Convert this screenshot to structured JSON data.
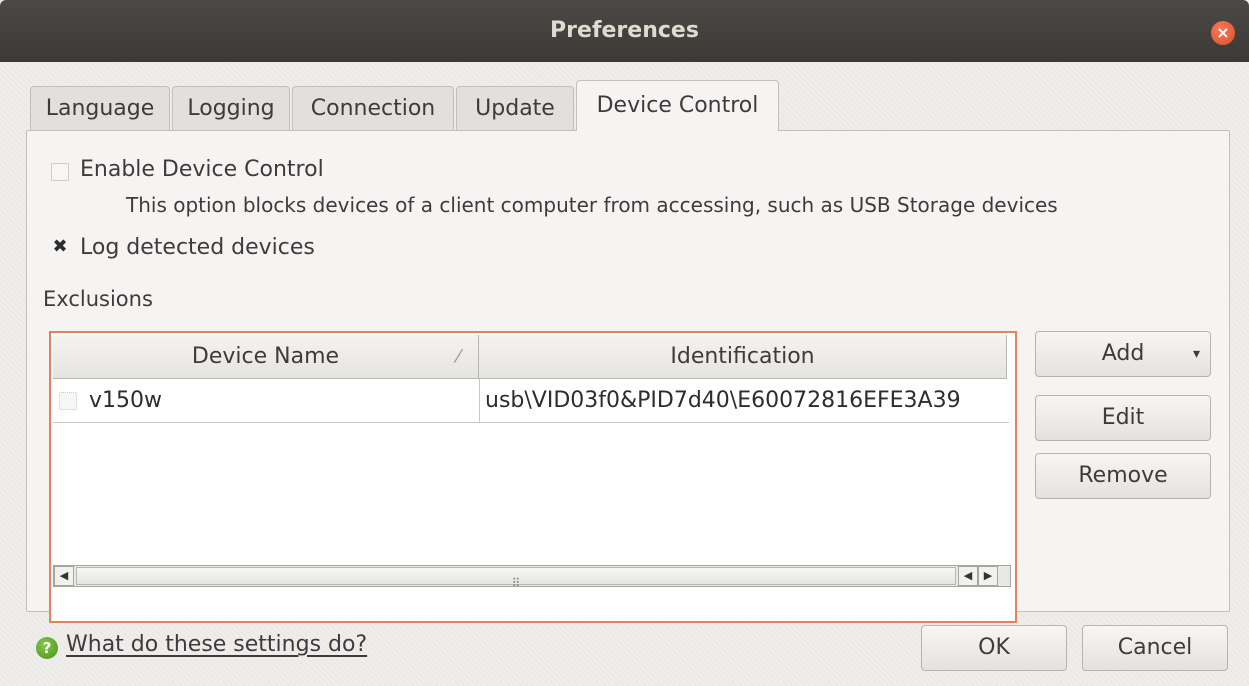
{
  "window": {
    "title": "Preferences",
    "close_glyph": "×"
  },
  "tabs": [
    {
      "label": "Language"
    },
    {
      "label": "Logging"
    },
    {
      "label": "Connection"
    },
    {
      "label": "Update"
    },
    {
      "label": "Device Control",
      "active": true
    }
  ],
  "device_control": {
    "enable_label": "Enable Device Control",
    "enable_checked": false,
    "enable_description": "This option blocks devices of a client computer from accessing, such as USB Storage devices",
    "log_label": "Log detected devices",
    "log_checked": true,
    "log_glyph": "✖",
    "exclusions_label": "Exclusions",
    "table": {
      "columns": [
        "Device Name",
        "Identification"
      ],
      "sort_glyph": "⁄",
      "rows": [
        {
          "checked": false,
          "device_name": "v150w",
          "identification": "usb\\VID03f0&PID7d40\\E60072816EFE3A39"
        }
      ]
    },
    "scrollbar": {
      "left_glyph": "◀",
      "right_glyph": "▶",
      "grip": "⠿"
    },
    "buttons": {
      "add": "Add",
      "add_dropdown_glyph": "▾",
      "edit": "Edit",
      "remove": "Remove"
    }
  },
  "footer": {
    "help_icon_glyph": "?",
    "help_link": "What do these settings do?",
    "ok": "OK",
    "cancel": "Cancel"
  },
  "colors": {
    "accent": "#e2825f",
    "titlebar": "#3b3a36",
    "close": "#e0502a",
    "help_icon": "#5aa02c"
  }
}
